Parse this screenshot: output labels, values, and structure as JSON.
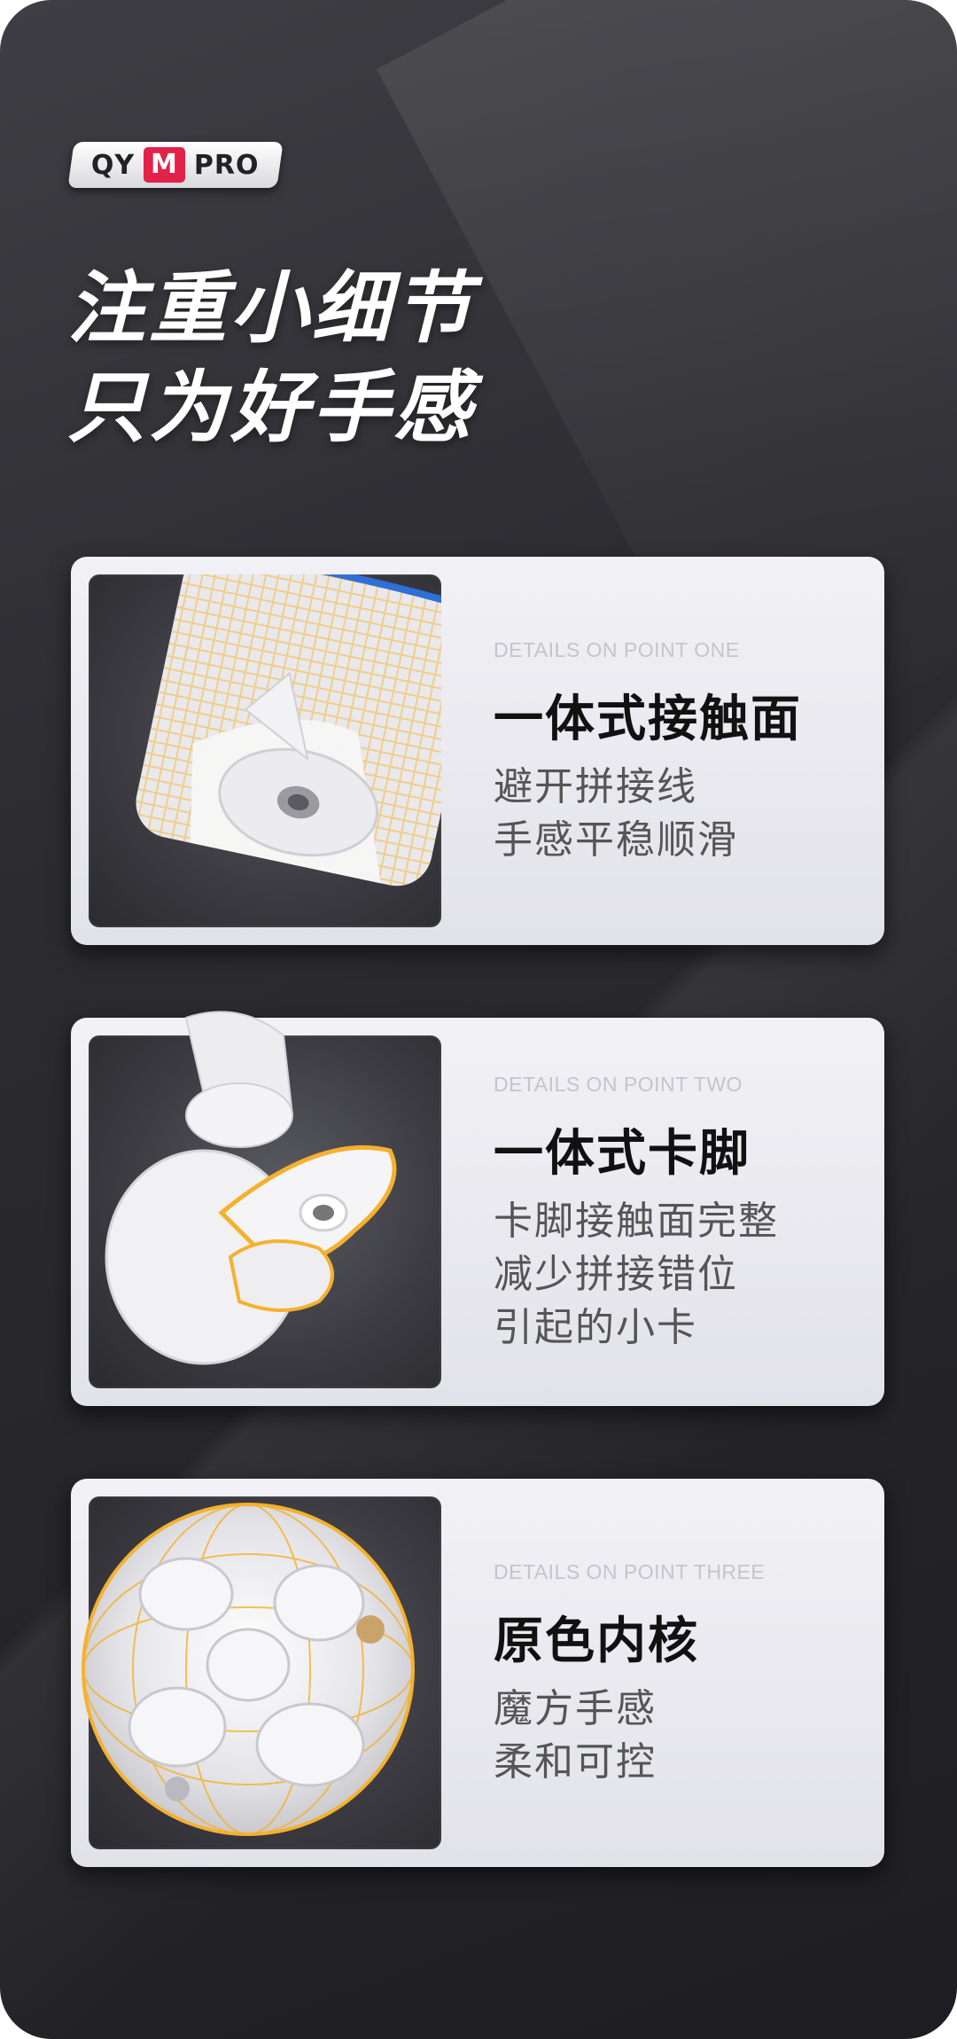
{
  "brand": {
    "left": "QY",
    "mid": "M",
    "right": "PRO"
  },
  "headline": {
    "line1": "注重小细节",
    "line2": "只为好手感"
  },
  "details": [
    {
      "subtitle": "DETAILS ON POINT ONE",
      "title": "一体式接触面",
      "lines": [
        "避开拼接线",
        "手感平稳顺滑"
      ]
    },
    {
      "subtitle": "DETAILS ON POINT TWO",
      "title": "一体式卡脚",
      "lines": [
        "卡脚接触面完整",
        "减少拼接错位",
        "引起的小卡"
      ]
    },
    {
      "subtitle": "DETAILS ON POINT THREE",
      "title": "原色内核",
      "lines": [
        "魔方手感",
        "柔和可控"
      ]
    }
  ],
  "colors": {
    "accent": "#e3224a",
    "highlight": "#f5b12e",
    "edge_blue": "#2f6fd6"
  }
}
